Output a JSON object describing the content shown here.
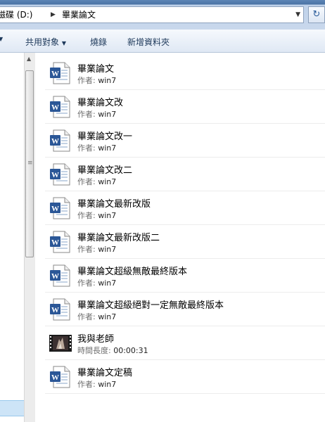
{
  "address": {
    "drive": "磁碟 (D:)",
    "folder": "畢業論文"
  },
  "toolbar": {
    "share": "共用對象",
    "burn": "燒錄",
    "new_folder": "新增資料夾"
  },
  "files": [
    {
      "name": "畢業論文",
      "meta_label": "作者:",
      "meta_value": "win7",
      "icon": "word-document-icon"
    },
    {
      "name": "畢業論文改",
      "meta_label": "作者:",
      "meta_value": "win7",
      "icon": "word-document-icon"
    },
    {
      "name": "畢業論文改一",
      "meta_label": "作者:",
      "meta_value": "win7",
      "icon": "word-document-icon"
    },
    {
      "name": "畢業論文改二",
      "meta_label": "作者:",
      "meta_value": "win7",
      "icon": "word-document-icon"
    },
    {
      "name": "畢業論文最新改版",
      "meta_label": "作者:",
      "meta_value": "win7",
      "icon": "word-document-icon"
    },
    {
      "name": "畢業論文最新改版二",
      "meta_label": "作者:",
      "meta_value": "win7",
      "icon": "word-document-icon"
    },
    {
      "name": "畢業論文超級無敵最終版本",
      "meta_label": "作者:",
      "meta_value": "win7",
      "icon": "word-document-icon"
    },
    {
      "name": "畢業論文超級絕對一定無敵最終版本",
      "meta_label": "作者:",
      "meta_value": "win7",
      "icon": "word-document-icon"
    },
    {
      "name": "我與老師",
      "meta_label": "時間長度:",
      "meta_value": "00:00:31",
      "icon": "video-thumbnail-icon"
    },
    {
      "name": "畢業論文定稿",
      "meta_label": "作者:",
      "meta_value": "win7",
      "icon": "word-document-icon"
    }
  ]
}
